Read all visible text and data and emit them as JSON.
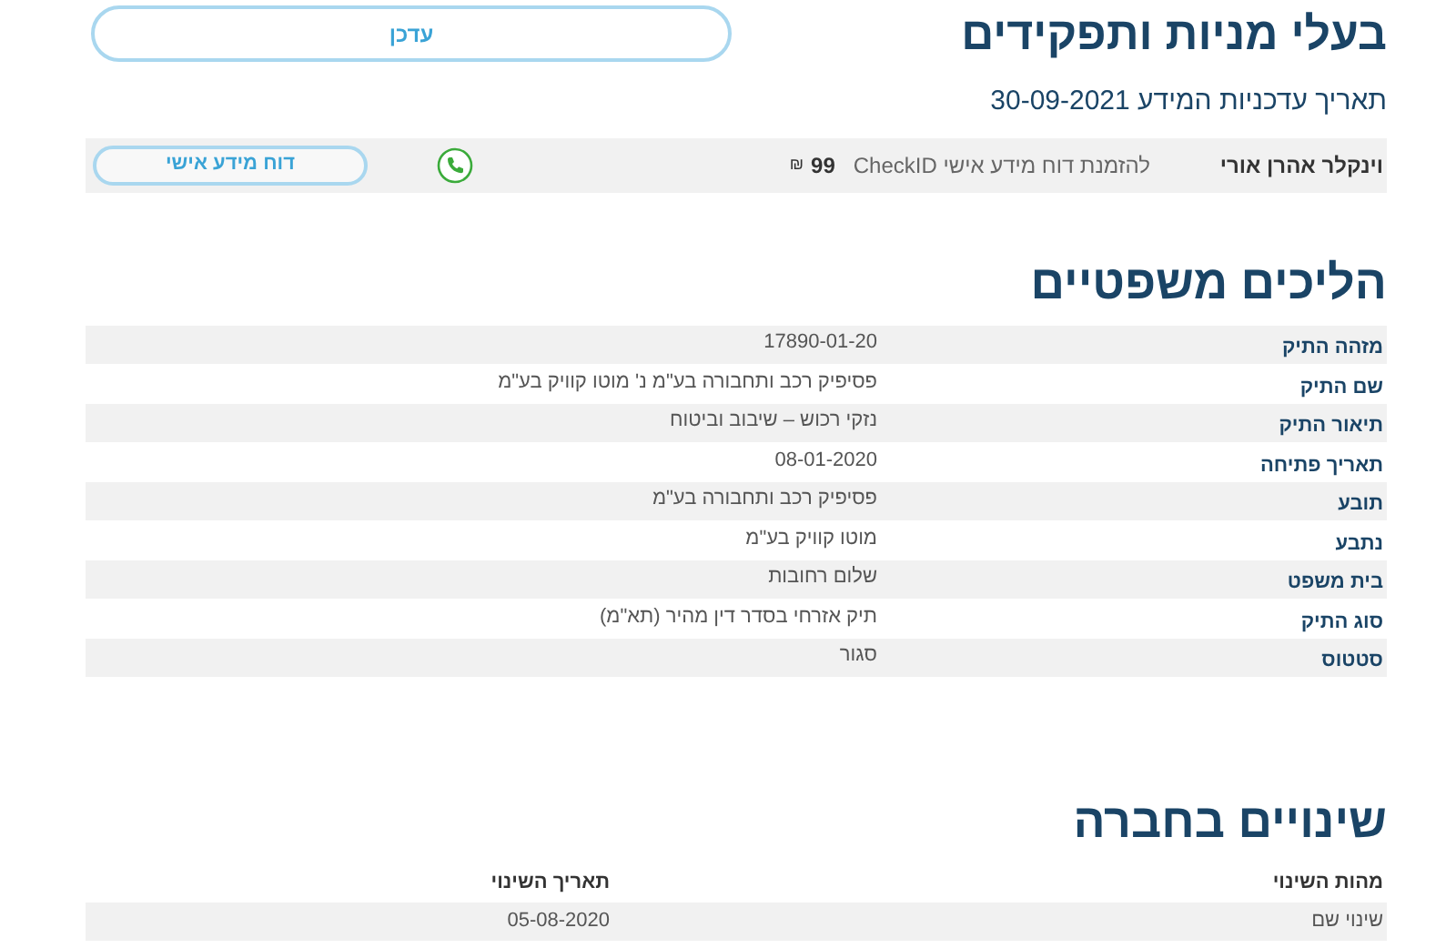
{
  "header": {
    "title": "בעלי מניות ותפקידים",
    "update_button": "עדכן",
    "updated_date": "תאריך עדכניות המידע 30-09-2021"
  },
  "person_row": {
    "name": "וינקלר אהרן אורי",
    "order_text": "להזמנת דוח מידע אישי CheckID",
    "price": "99",
    "currency": "₪",
    "report_button": "דוח מידע אישי"
  },
  "legal": {
    "title": "הליכים משפטיים",
    "rows": [
      {
        "label": "מזהה התיק",
        "value": "17890-01-20"
      },
      {
        "label": "שם התיק",
        "value": "פסיפיק רכב ותחבורה בע\"מ נ' מוטו קוויק בע\"מ"
      },
      {
        "label": "תיאור התיק",
        "value": "נזקי רכוש – שיבוב וביטוח"
      },
      {
        "label": "תאריך פתיחה",
        "value": "08-01-2020"
      },
      {
        "label": "תובע",
        "value": "פסיפיק רכב ותחבורה בע\"מ"
      },
      {
        "label": "נתבע",
        "value": "מוטו קוויק בע\"מ"
      },
      {
        "label": "בית משפט",
        "value": "שלום רחובות"
      },
      {
        "label": "סוג התיק",
        "value": "תיק אזרחי בסדר דין מהיר (תא\"מ)"
      },
      {
        "label": "סטטוס",
        "value": "סגור"
      }
    ]
  },
  "changes": {
    "title": "שינויים בחברה",
    "columns": [
      "מהות השינוי",
      "תאריך השינוי"
    ],
    "rows": [
      [
        "שינוי שם",
        "05-08-2020"
      ]
    ]
  }
}
